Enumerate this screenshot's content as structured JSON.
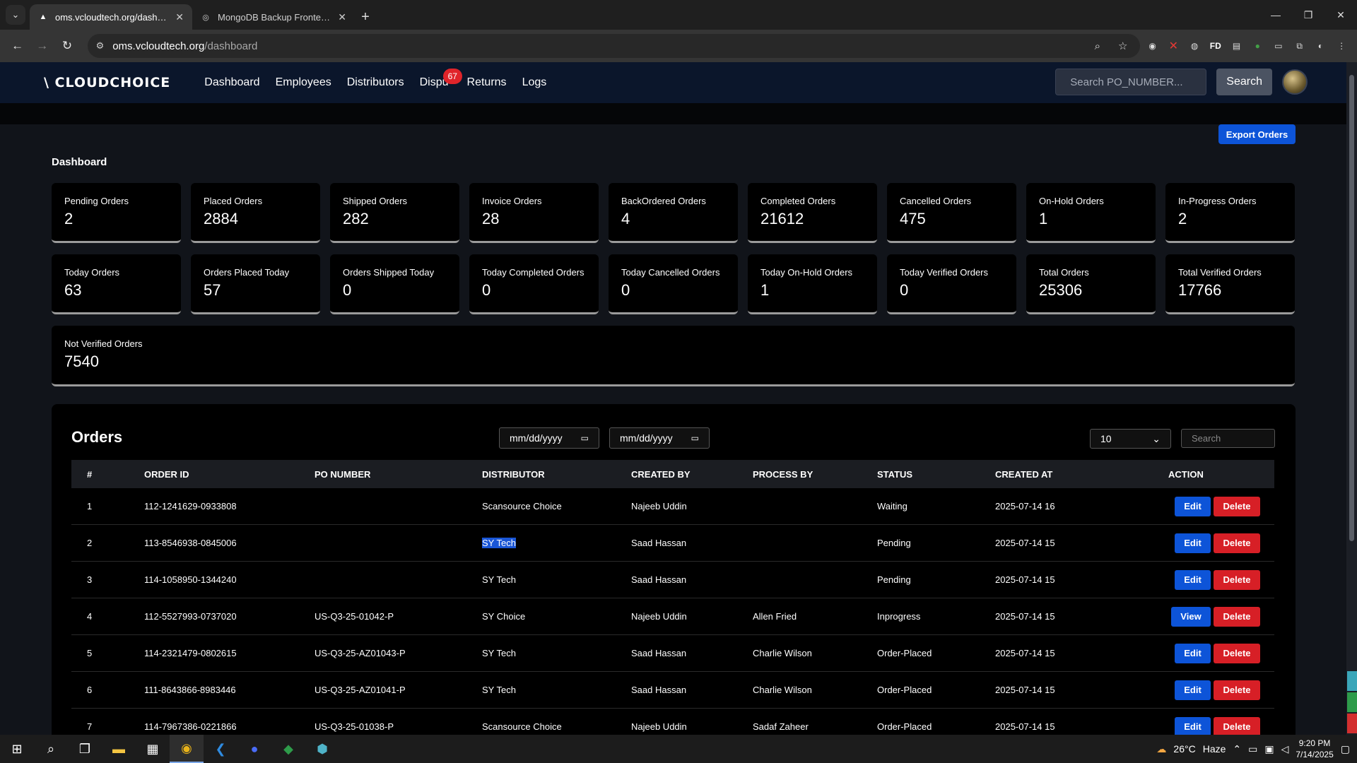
{
  "browser": {
    "tabs": [
      {
        "title": "oms.vcloudtech.org/dashboard",
        "favicon": "▲",
        "active": true
      },
      {
        "title": "MongoDB Backup Frontend Int",
        "favicon": "◎",
        "active": false
      }
    ],
    "address": {
      "host": "oms.vcloudtech.org",
      "path": "/dashboard"
    }
  },
  "navbar": {
    "logo": "\\ CLOUDCHOICE",
    "links": [
      {
        "label": "Dashboard"
      },
      {
        "label": "Employees"
      },
      {
        "label": "Distributors"
      },
      {
        "label": "Dispu",
        "badge": "67"
      },
      {
        "label": "Returns"
      },
      {
        "label": "Logs"
      }
    ],
    "search_placeholder": "Search PO_NUMBER...",
    "search_button": "Search"
  },
  "dashboard": {
    "export_label": "Export Orders",
    "title": "Dashboard",
    "cards": [
      {
        "label": "Pending Orders",
        "value": "2"
      },
      {
        "label": "Placed Orders",
        "value": "2884"
      },
      {
        "label": "Shipped Orders",
        "value": "282"
      },
      {
        "label": "Invoice Orders",
        "value": "28"
      },
      {
        "label": "BackOrdered Orders",
        "value": "4"
      },
      {
        "label": "Completed Orders",
        "value": "21612"
      },
      {
        "label": "Cancelled Orders",
        "value": "475"
      },
      {
        "label": "On-Hold Orders",
        "value": "1"
      },
      {
        "label": "In-Progress Orders",
        "value": "2"
      },
      {
        "label": "Today Orders",
        "value": "63"
      },
      {
        "label": "Orders Placed Today",
        "value": "57"
      },
      {
        "label": "Orders Shipped Today",
        "value": "0"
      },
      {
        "label": "Today Completed Orders",
        "value": "0"
      },
      {
        "label": "Today Cancelled Orders",
        "value": "0"
      },
      {
        "label": "Today On-Hold Orders",
        "value": "1"
      },
      {
        "label": "Today Verified Orders",
        "value": "0"
      },
      {
        "label": "Total Orders",
        "value": "25306"
      },
      {
        "label": "Total Verified Orders",
        "value": "17766"
      },
      {
        "label": "Not Verified Orders",
        "value": "7540"
      }
    ]
  },
  "orders": {
    "title": "Orders",
    "date_from": "mm/dd/yyyy",
    "date_to": "mm/dd/yyyy",
    "per_page": "10",
    "search_placeholder": "Search",
    "headers": [
      "#",
      "ORDER ID",
      "PO NUMBER",
      "DISTRIBUTOR",
      "CREATED BY",
      "PROCESS BY",
      "STATUS",
      "CREATED AT",
      "ACTION"
    ],
    "rows": [
      {
        "num": "1",
        "order_id": "112-1241629-0933808",
        "po": "",
        "distributor": "Scansource Choice",
        "created_by": "Najeeb Uddin",
        "process_by": "",
        "status": "Waiting",
        "created_at": "2025-07-14 16",
        "primary_action": "Edit",
        "delete": "Delete"
      },
      {
        "num": "2",
        "order_id": "113-8546938-0845006",
        "po": "",
        "distributor": "SY Tech",
        "created_by": "Saad Hassan",
        "process_by": "",
        "status": "Pending",
        "created_at": "2025-07-14 15",
        "primary_action": "Edit",
        "delete": "Delete",
        "selected_distributor": true
      },
      {
        "num": "3",
        "order_id": "114-1058950-1344240",
        "po": "",
        "distributor": "SY Tech",
        "created_by": "Saad Hassan",
        "process_by": "",
        "status": "Pending",
        "created_at": "2025-07-14 15",
        "primary_action": "Edit",
        "delete": "Delete"
      },
      {
        "num": "4",
        "order_id": "112-5527993-0737020",
        "po": "US-Q3-25-01042-P",
        "distributor": "SY Choice",
        "created_by": "Najeeb Uddin",
        "process_by": "Allen Fried",
        "status": "Inprogress",
        "created_at": "2025-07-14 15",
        "primary_action": "View",
        "delete": "Delete"
      },
      {
        "num": "5",
        "order_id": "114-2321479-0802615",
        "po": "US-Q3-25-AZ01043-P",
        "distributor": "SY Tech",
        "created_by": "Saad Hassan",
        "process_by": "Charlie Wilson",
        "status": "Order-Placed",
        "created_at": "2025-07-14 15",
        "primary_action": "Edit",
        "delete": "Delete"
      },
      {
        "num": "6",
        "order_id": "111-8643866-8983446",
        "po": "US-Q3-25-AZ01041-P",
        "distributor": "SY Tech",
        "created_by": "Saad Hassan",
        "process_by": "Charlie Wilson",
        "status": "Order-Placed",
        "created_at": "2025-07-14 15",
        "primary_action": "Edit",
        "delete": "Delete"
      },
      {
        "num": "7",
        "order_id": "114-7967386-0221866",
        "po": "US-Q3-25-01038-P",
        "distributor": "Scansource Choice",
        "created_by": "Najeeb Uddin",
        "process_by": "Sadaf Zaheer",
        "status": "Order-Placed",
        "created_at": "2025-07-14 15",
        "primary_action": "Edit",
        "delete": "Delete"
      }
    ]
  },
  "taskbar": {
    "weather_temp": "26°C",
    "weather_text": "Haze",
    "time": "9:20 PM",
    "date": "7/14/2025"
  }
}
